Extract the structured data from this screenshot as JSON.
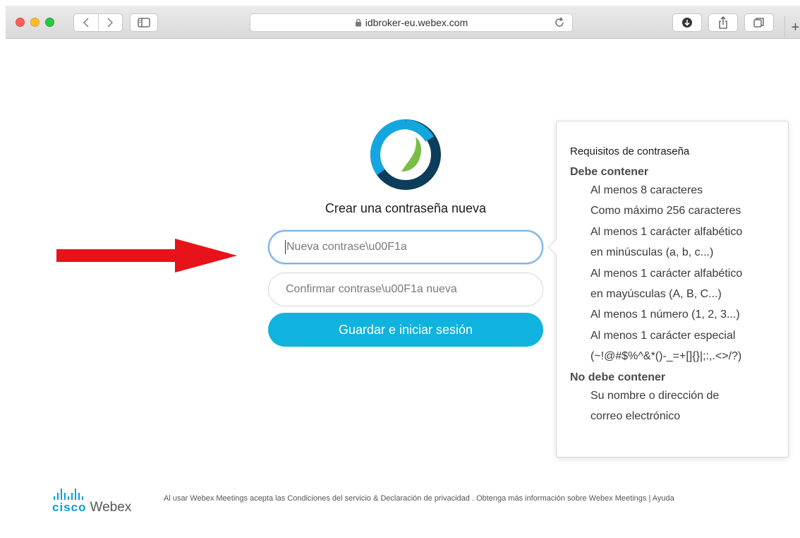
{
  "browser": {
    "url": "idbroker-eu.webex.com"
  },
  "page": {
    "heading": "Crear una contraseña nueva",
    "password_placeholder": "Nueva contrase\\u00F1a",
    "confirm_placeholder": "Confirmar contrase\\u00F1a nueva",
    "save_button": "Guardar e iniciar sesión"
  },
  "requirements": {
    "title": "Requisitos de contraseña",
    "must_contain_heading": "Debe contener",
    "must_contain": [
      "Al menos 8 caracteres",
      "Como máximo 256 caracteres",
      "Al menos 1 carácter alfabético",
      "en minúsculas (a, b, c...)",
      "Al menos 1 carácter alfabético",
      "en mayúsculas (A, B, C...)",
      "Al menos 1 número (1, 2, 3...)",
      "Al menos 1 carácter especial",
      "(~!@#$%^&*()-_=+[]{}|;:,.<>/?)"
    ],
    "must_not_contain_heading": "No debe contener",
    "must_not_contain": [
      "Su nombre o dirección de",
      "correo electrónico"
    ]
  },
  "footer": {
    "brand_cisco": "cisco",
    "brand_webex": "Webex",
    "legal_text": "Al usar Webex Meetings acepta las Condiciones del servicio & Declaración de privacidad . Obtenga más información sobre Webex Meetings | Ayuda"
  },
  "colors": {
    "accent": "#0fb3dd",
    "arrow": "#e8131a",
    "focus_border": "#7fb2ea",
    "cisco_blue": "#049fd9"
  },
  "icons": {
    "toolbar": [
      "back-icon",
      "forward-icon",
      "sidebar-icon",
      "lock-icon",
      "reload-icon",
      "download-icon",
      "share-icon",
      "tabs-icon",
      "plus-icon"
    ],
    "annotation": "red-arrow"
  }
}
